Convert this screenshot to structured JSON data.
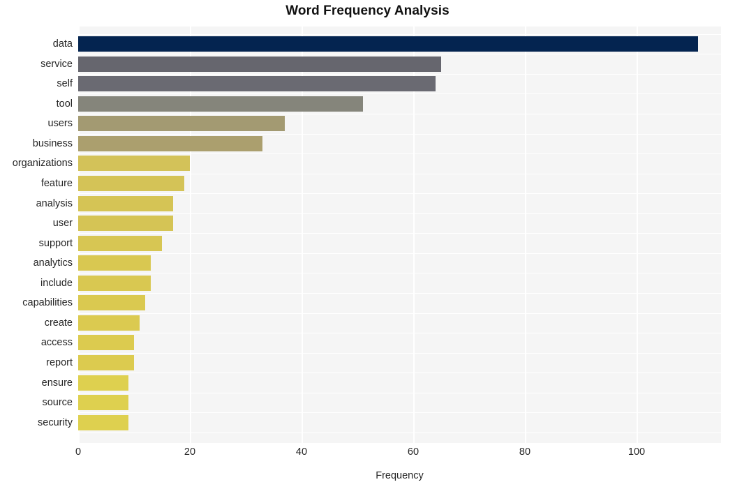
{
  "chart_data": {
    "type": "bar",
    "orientation": "horizontal",
    "title": "Word Frequency Analysis",
    "xlabel": "Frequency",
    "ylabel": "",
    "xlim": [
      0,
      115
    ],
    "ylim": null,
    "grid": true,
    "legend": null,
    "xticks": [
      0,
      20,
      40,
      60,
      80,
      100
    ],
    "xtick_labels": [
      "0",
      "20",
      "40",
      "60",
      "80",
      "100"
    ],
    "categories": [
      "data",
      "service",
      "self",
      "tool",
      "users",
      "business",
      "organizations",
      "feature",
      "analysis",
      "user",
      "support",
      "analytics",
      "include",
      "capabilities",
      "create",
      "access",
      "report",
      "ensure",
      "source",
      "security"
    ],
    "values": [
      111,
      65,
      64,
      51,
      37,
      33,
      20,
      19,
      17,
      17,
      15,
      13,
      13,
      12,
      11,
      10,
      10,
      9,
      9,
      9
    ],
    "bar_colors": [
      "#042450",
      "#66666e",
      "#6a6a72",
      "#85857b",
      "#a39a72",
      "#ab9f6e",
      "#d3c259",
      "#d4c357",
      "#d5c455",
      "#d5c455",
      "#d7c653",
      "#d9c851",
      "#d9c851",
      "#dac950",
      "#dbca50",
      "#dccb4f",
      "#dccb4f",
      "#ded04f",
      "#ded04f",
      "#ded04f"
    ],
    "plot_background": "#f5f5f5",
    "gridline_color": "#ffffff",
    "figure_background": "#ffffff"
  }
}
